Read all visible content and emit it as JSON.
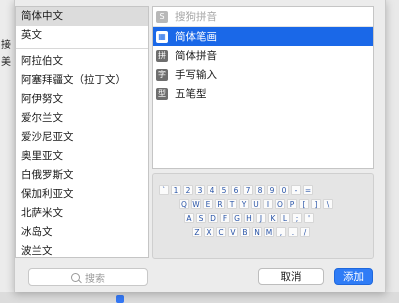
{
  "background": {
    "left_labels": [
      "接",
      "美"
    ],
    "checkbox_label": "☑"
  },
  "languages": [
    {
      "label": "简体中文",
      "selected": true
    },
    {
      "label": "英文",
      "selected": false
    },
    {
      "separator": true
    },
    {
      "label": "阿拉伯文",
      "selected": false
    },
    {
      "label": "阿塞拜疆文（拉丁文）",
      "selected": false
    },
    {
      "label": "阿伊努文",
      "selected": false
    },
    {
      "label": "爱尔兰文",
      "selected": false
    },
    {
      "label": "爱沙尼亚文",
      "selected": false
    },
    {
      "label": "奥里亚文",
      "selected": false
    },
    {
      "label": "白俄罗斯文",
      "selected": false
    },
    {
      "label": "保加利亚文",
      "selected": false
    },
    {
      "label": "北萨米文",
      "selected": false
    },
    {
      "label": "冰岛文",
      "selected": false
    },
    {
      "label": "波兰文",
      "selected": false
    }
  ],
  "input_methods": [
    {
      "label": "搜狗拼音",
      "icon": "S",
      "icon_name": "sogou-icon",
      "state": "disabled"
    },
    {
      "label": "简体笔画",
      "icon": "▦",
      "icon_name": "stroke-icon",
      "state": "selected"
    },
    {
      "label": "简体拼音",
      "icon": "拼",
      "icon_name": "pinyin-icon",
      "state": "normal"
    },
    {
      "label": "手写输入",
      "icon": "字",
      "icon_name": "handwriting-icon",
      "state": "normal"
    },
    {
      "label": "五笔型",
      "icon": "型",
      "icon_name": "wubi-icon",
      "state": "normal"
    }
  ],
  "keyboard": {
    "rows": [
      [
        "`",
        "1",
        "2",
        "3",
        "4",
        "5",
        "6",
        "7",
        "8",
        "9",
        "0",
        "-",
        "="
      ],
      [
        "Q",
        "W",
        "E",
        "R",
        "T",
        "Y",
        "U",
        "I",
        "O",
        "P",
        "[",
        "]",
        "\\"
      ],
      [
        "A",
        "S",
        "D",
        "F",
        "G",
        "H",
        "J",
        "K",
        "L",
        ";",
        "'"
      ],
      [
        "Z",
        "X",
        "C",
        "V",
        "B",
        "N",
        "M",
        ",",
        ".",
        "/"
      ]
    ]
  },
  "search": {
    "placeholder": "搜索"
  },
  "buttons": {
    "cancel": "取消",
    "add": "添加"
  },
  "colors": {
    "accent": "#2f7cf6",
    "selection": "#1a68e8",
    "key_text": "#2a55a8"
  }
}
